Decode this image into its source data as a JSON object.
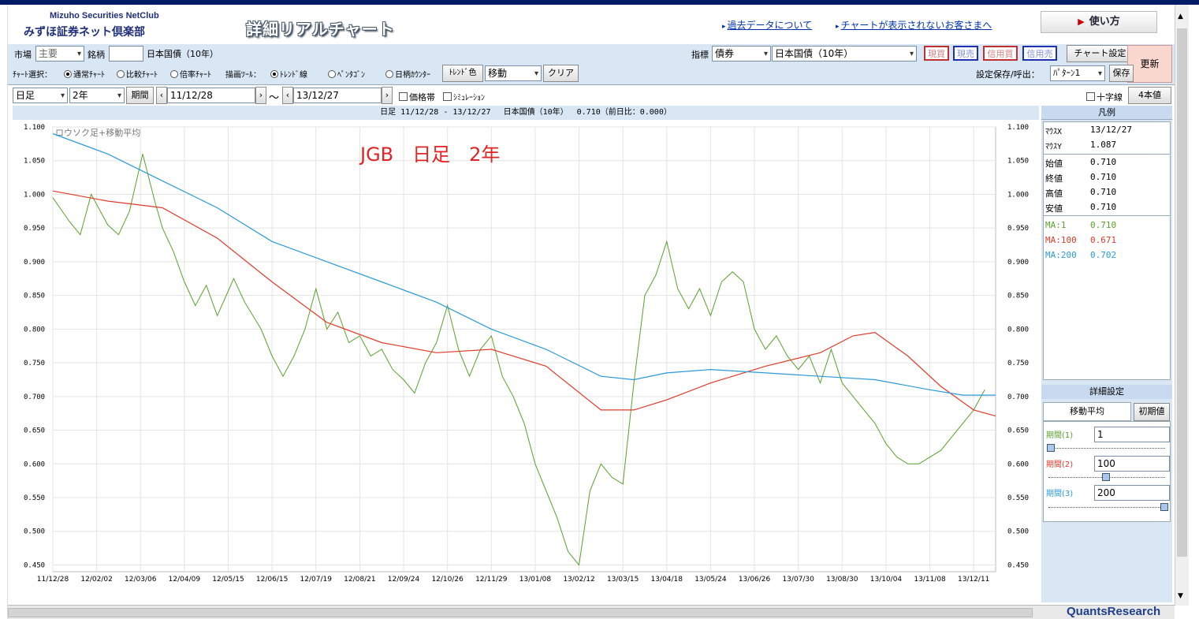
{
  "header": {
    "brand_en": "Mizuho Securities NetClub",
    "brand_jp": "みずほ証券ネット倶楽部",
    "app_title": "詳細リアルチャート",
    "link_past_data": "過去データについて",
    "link_chart_help": "チャートが表示されないお客さまへ",
    "usage_label": "使い方",
    "usage_icon": "▶"
  },
  "toolbar": {
    "market_label": "市場",
    "market_value": "主要",
    "issue_label": "銘柄",
    "issue_code": "",
    "issue_name": "日本国債（10年）",
    "indicator_label": "指標",
    "indicator_value": "債券",
    "indicator_issue": "日本国債（10年）",
    "trade": [
      {
        "label": "現買",
        "color": "#c03030"
      },
      {
        "label": "現売",
        "color": "#2030b0"
      },
      {
        "label": "信用買",
        "color": "#c03030"
      },
      {
        "label": "信用売",
        "color": "#2030b0"
      }
    ],
    "chart_settings": "チャート設定",
    "refresh": "更新",
    "chart_select_label": "ﾁｬｰﾄ選択：",
    "chart_types": [
      "通常ﾁｬｰﾄ",
      "比較ﾁｬｰﾄ",
      "倍率ﾁｬｰﾄ"
    ],
    "draw_tool_label": "描画ﾂｰﾙ：",
    "draw_tools": [
      "ﾄﾚﾝﾄﾞ線",
      "ﾍﾟﾝﾀｺﾞﾝ",
      "日柄ｶｳﾝﾀｰ"
    ],
    "trend_color": "ﾄﾚﾝﾄﾞ色",
    "move_value": "移動",
    "clear": "クリア",
    "save_label": "設定保存/呼出：",
    "pattern_value": "ﾊﾟﾀｰﾝ1",
    "save": "保存",
    "period_type": "日足",
    "period_length": "2年",
    "period_btn": "期間",
    "date_from": "11/12/28",
    "tilde": "〜",
    "date_to": "13/12/27",
    "price_band": "価格帯",
    "simulation": "ｼﾐｭﾚｰｼｮﾝ",
    "crosshair": "十字線",
    "four_values": "4本値"
  },
  "chart_header": "日足 11/12/28 - 13/12/27　 日本国債（10年）　 0.710（前日比：0.000）",
  "chart_data": {
    "type": "line",
    "title": "JGB　日足　2年",
    "subtitle": "ロウソク足+移動平均",
    "ylim": [
      0.44,
      1.1
    ],
    "yticks": [
      "1.100",
      "1.050",
      "1.000",
      "0.950",
      "0.900",
      "0.850",
      "0.800",
      "0.750",
      "0.700",
      "0.650",
      "0.600",
      "0.550",
      "0.500",
      "0.450"
    ],
    "xticks": [
      "11/12/28",
      "12/02/02",
      "12/03/06",
      "12/04/09",
      "12/05/15",
      "12/06/15",
      "12/07/19",
      "12/08/21",
      "12/09/24",
      "12/10/26",
      "12/11/29",
      "13/01/08",
      "13/02/12",
      "13/03/15",
      "13/04/18",
      "13/05/24",
      "13/06/26",
      "13/07/30",
      "13/08/30",
      "13/10/04",
      "13/11/08",
      "13/12/11"
    ],
    "series": [
      {
        "name": "MA:1",
        "color": "#5aa02c",
        "values": [
          [
            0,
            0.995
          ],
          [
            1.5,
            0.96
          ],
          [
            2.5,
            0.94
          ],
          [
            3.5,
            1.0
          ],
          [
            5,
            0.955
          ],
          [
            6,
            0.94
          ],
          [
            7,
            0.975
          ],
          [
            8.2,
            1.06
          ],
          [
            9.3,
            0.99
          ],
          [
            10,
            0.95
          ],
          [
            11,
            0.915
          ],
          [
            12,
            0.87
          ],
          [
            13,
            0.835
          ],
          [
            14,
            0.865
          ],
          [
            15,
            0.82
          ],
          [
            16.5,
            0.875
          ],
          [
            17.5,
            0.84
          ],
          [
            19,
            0.8
          ],
          [
            20,
            0.76
          ],
          [
            21,
            0.73
          ],
          [
            22,
            0.76
          ],
          [
            23,
            0.8
          ],
          [
            24,
            0.86
          ],
          [
            25,
            0.8
          ],
          [
            26,
            0.825
          ],
          [
            27,
            0.78
          ],
          [
            28,
            0.79
          ],
          [
            29,
            0.76
          ],
          [
            30,
            0.77
          ],
          [
            31,
            0.74
          ],
          [
            32,
            0.725
          ],
          [
            33,
            0.705
          ],
          [
            34,
            0.75
          ],
          [
            35,
            0.78
          ],
          [
            36,
            0.835
          ],
          [
            37,
            0.77
          ],
          [
            38,
            0.73
          ],
          [
            39,
            0.77
          ],
          [
            40,
            0.79
          ],
          [
            41,
            0.73
          ],
          [
            42,
            0.7
          ],
          [
            43,
            0.66
          ],
          [
            44,
            0.6
          ],
          [
            45,
            0.56
          ],
          [
            46,
            0.52
          ],
          [
            47,
            0.47
          ],
          [
            48,
            0.45
          ],
          [
            49,
            0.56
          ],
          [
            50,
            0.6
          ],
          [
            51,
            0.58
          ],
          [
            52,
            0.57
          ],
          [
            53,
            0.72
          ],
          [
            54,
            0.85
          ],
          [
            55,
            0.88
          ],
          [
            56,
            0.93
          ],
          [
            57,
            0.86
          ],
          [
            58,
            0.83
          ],
          [
            59,
            0.86
          ],
          [
            60,
            0.82
          ],
          [
            61,
            0.87
          ],
          [
            62,
            0.885
          ],
          [
            63,
            0.87
          ],
          [
            64,
            0.8
          ],
          [
            65,
            0.77
          ],
          [
            66,
            0.79
          ],
          [
            67,
            0.76
          ],
          [
            68,
            0.74
          ],
          [
            69,
            0.76
          ],
          [
            70,
            0.72
          ],
          [
            71,
            0.77
          ],
          [
            72,
            0.72
          ],
          [
            73,
            0.7
          ],
          [
            74,
            0.68
          ],
          [
            75,
            0.66
          ],
          [
            76,
            0.63
          ],
          [
            77,
            0.61
          ],
          [
            78,
            0.6
          ],
          [
            79,
            0.6
          ],
          [
            80,
            0.61
          ],
          [
            81,
            0.62
          ],
          [
            82,
            0.64
          ],
          [
            83,
            0.66
          ],
          [
            84,
            0.68
          ],
          [
            85,
            0.71
          ]
        ]
      },
      {
        "name": "MA:100",
        "color": "#e03b2a",
        "values": [
          [
            0,
            1.005
          ],
          [
            5,
            0.99
          ],
          [
            10,
            0.98
          ],
          [
            15,
            0.935
          ],
          [
            20,
            0.87
          ],
          [
            25,
            0.81
          ],
          [
            30,
            0.78
          ],
          [
            35,
            0.765
          ],
          [
            40,
            0.77
          ],
          [
            45,
            0.745
          ],
          [
            50,
            0.68
          ],
          [
            53,
            0.68
          ],
          [
            56,
            0.695
          ],
          [
            60,
            0.72
          ],
          [
            65,
            0.745
          ],
          [
            70,
            0.765
          ],
          [
            73,
            0.79
          ],
          [
            75,
            0.795
          ],
          [
            78,
            0.76
          ],
          [
            81,
            0.715
          ],
          [
            84,
            0.68
          ],
          [
            86,
            0.671
          ]
        ]
      },
      {
        "name": "MA:200",
        "color": "#2a9ad8",
        "values": [
          [
            0,
            1.09
          ],
          [
            5,
            1.06
          ],
          [
            10,
            1.02
          ],
          [
            15,
            0.98
          ],
          [
            20,
            0.93
          ],
          [
            25,
            0.9
          ],
          [
            30,
            0.87
          ],
          [
            35,
            0.84
          ],
          [
            40,
            0.8
          ],
          [
            45,
            0.77
          ],
          [
            50,
            0.73
          ],
          [
            53,
            0.725
          ],
          [
            56,
            0.735
          ],
          [
            60,
            0.74
          ],
          [
            65,
            0.735
          ],
          [
            70,
            0.73
          ],
          [
            75,
            0.725
          ],
          [
            80,
            0.71
          ],
          [
            83,
            0.702
          ],
          [
            86,
            0.702
          ]
        ]
      }
    ]
  },
  "legend": {
    "title": "凡例",
    "mouse_x_label": "ﾏｳｽX",
    "mouse_x": "13/12/27",
    "mouse_y_label": "ﾏｳｽY",
    "mouse_y": "1.087",
    "open_label": "始値",
    "open": "0.710",
    "close_label": "終値",
    "close": "0.710",
    "high_label": "高値",
    "high": "0.710",
    "low_label": "安値",
    "low": "0.710",
    "ma1_label": "MA:1",
    "ma1": "0.710",
    "ma100_label": "MA:100",
    "ma100": "0.671",
    "ma200_label": "MA:200",
    "ma200": "0.702"
  },
  "detail": {
    "title": "詳細設定",
    "tab": "移動平均",
    "reset": "初期値",
    "p1_label": "期間(1)",
    "p1": "1",
    "p2_label": "期間(2)",
    "p2": "100",
    "p3_label": "期間(3)",
    "p3": "200"
  },
  "footer": {
    "brand": "QuantsResearch"
  }
}
